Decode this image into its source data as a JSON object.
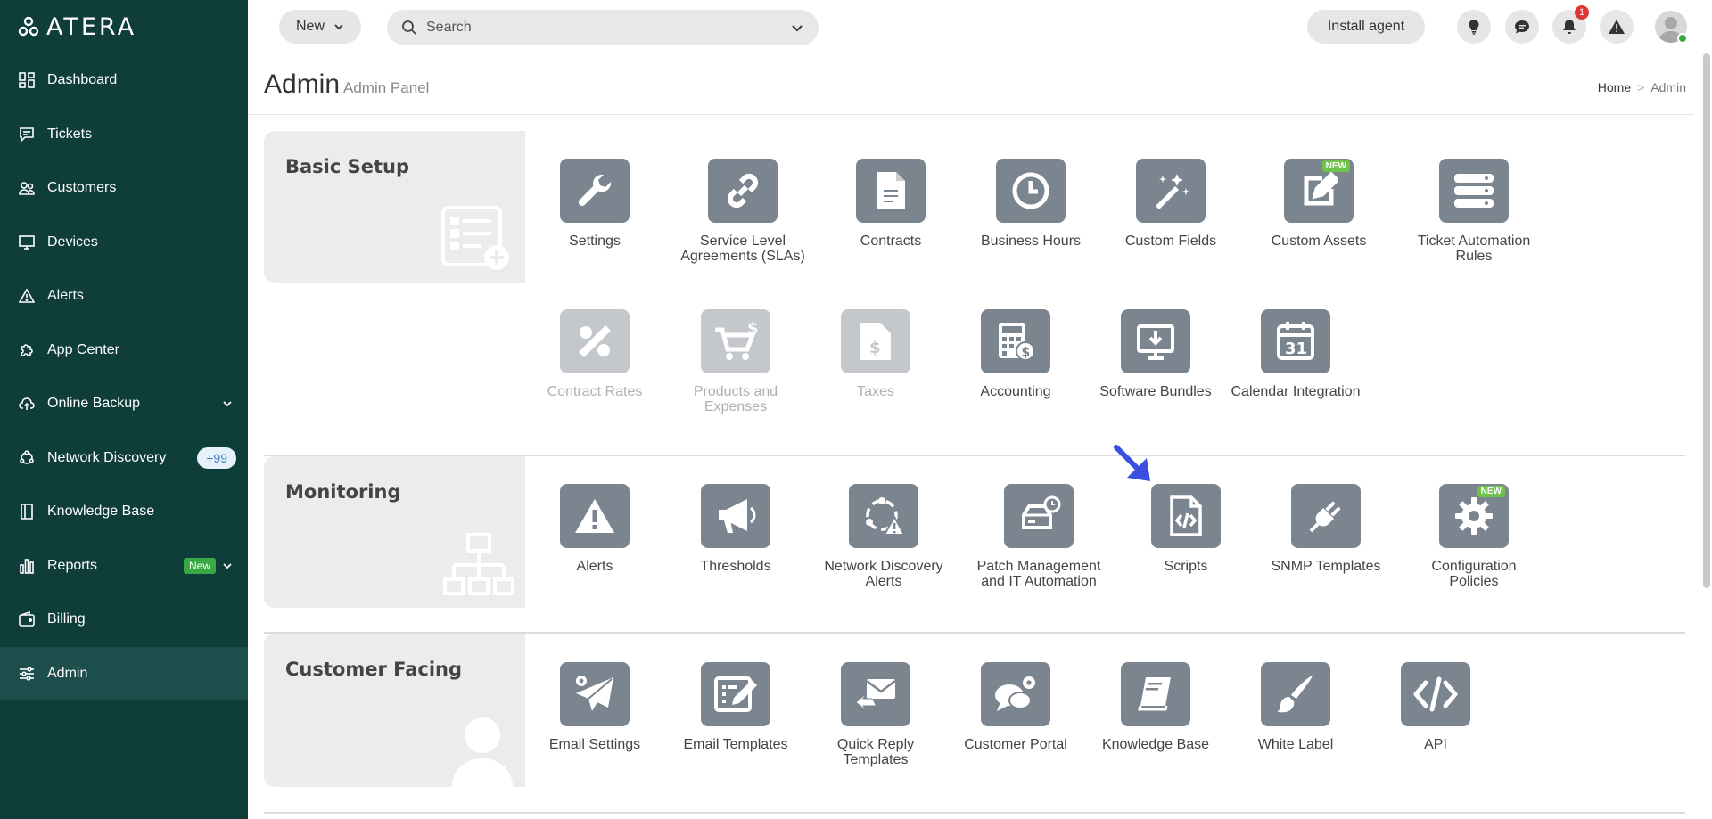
{
  "app": {
    "logo_text": "ATERA"
  },
  "sidebar": {
    "items": [
      {
        "label": "Dashboard",
        "icon": "dashboard-icon"
      },
      {
        "label": "Tickets",
        "icon": "tickets-icon"
      },
      {
        "label": "Customers",
        "icon": "customers-icon"
      },
      {
        "label": "Devices",
        "icon": "devices-icon"
      },
      {
        "label": "Alerts",
        "icon": "alert-triangle-icon"
      },
      {
        "label": "App Center",
        "icon": "puzzle-icon"
      },
      {
        "label": "Online Backup",
        "icon": "cloud-upload-icon"
      },
      {
        "label": "Network Discovery",
        "icon": "network-icon",
        "badge": "+99"
      },
      {
        "label": "Knowledge Base",
        "icon": "book-icon"
      },
      {
        "label": "Reports",
        "icon": "bar-chart-icon",
        "badge": "New"
      },
      {
        "label": "Billing",
        "icon": "wallet-icon"
      },
      {
        "label": "Admin",
        "icon": "sliders-icon"
      }
    ]
  },
  "topbar": {
    "new_label": "New",
    "search_placeholder": "Search",
    "install_label": "Install agent",
    "notification_count": "1"
  },
  "header": {
    "title": "Admin",
    "subtitle": "Admin Panel",
    "breadcrumb_home": "Home",
    "breadcrumb_sep": ">",
    "breadcrumb_current": "Admin"
  },
  "sections": {
    "basic": {
      "title": "Basic Setup",
      "tiles": [
        {
          "label": "Settings"
        },
        {
          "label": "Service Level Agreements (SLAs)"
        },
        {
          "label": "Contracts"
        },
        {
          "label": "Business Hours"
        },
        {
          "label": "Custom Fields"
        },
        {
          "label": "Custom Assets",
          "tag": "NEW"
        },
        {
          "label": "Ticket Automation Rules"
        },
        {
          "label": "Contract Rates"
        },
        {
          "label": "Products and Expenses"
        },
        {
          "label": "Taxes"
        },
        {
          "label": "Accounting"
        },
        {
          "label": "Software Bundles"
        },
        {
          "label": "Calendar Integration",
          "calendar_day": "31"
        }
      ]
    },
    "monitoring": {
      "title": "Monitoring",
      "tiles": [
        {
          "label": "Alerts"
        },
        {
          "label": "Thresholds"
        },
        {
          "label": "Network Discovery Alerts"
        },
        {
          "label": "Patch Management and IT Automation"
        },
        {
          "label": "Scripts"
        },
        {
          "label": "SNMP Templates"
        },
        {
          "label": "Configuration Policies",
          "tag": "NEW"
        }
      ]
    },
    "customer": {
      "title": "Customer Facing",
      "tiles": [
        {
          "label": "Email Settings"
        },
        {
          "label": "Email Templates"
        },
        {
          "label": "Quick Reply Templates"
        },
        {
          "label": "Customer Portal"
        },
        {
          "label": "Knowledge Base"
        },
        {
          "label": "White Label"
        },
        {
          "label": "API"
        }
      ]
    }
  },
  "colors": {
    "sidebar_bg": "#0e3d3a",
    "tile_bg": "#7b8590",
    "tile_disabled": "#c4c7cb",
    "new_tag": "#6fc24a",
    "arrow": "#3b4fe0"
  }
}
